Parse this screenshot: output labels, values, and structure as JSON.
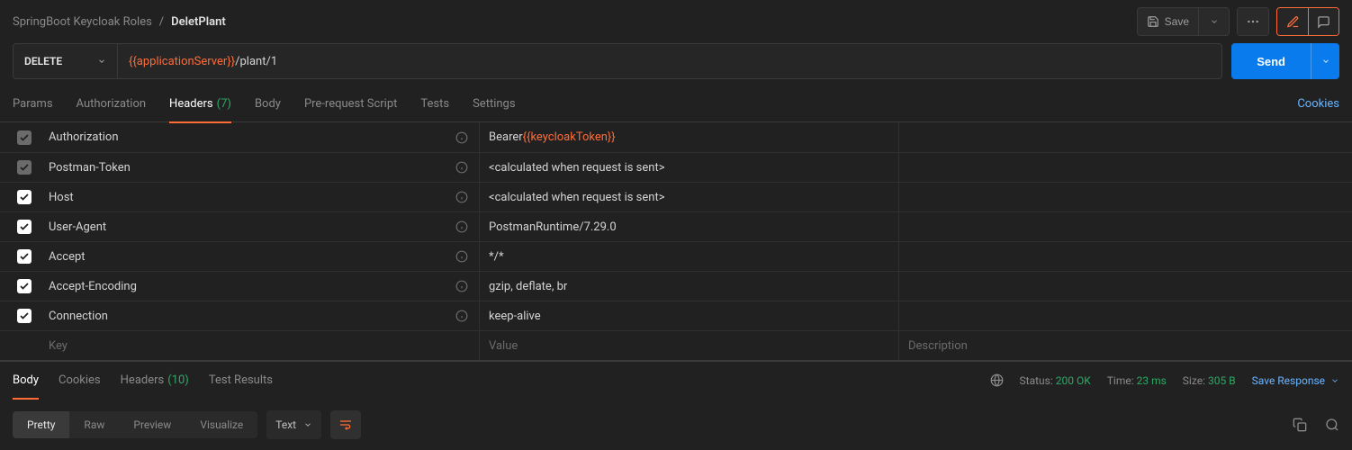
{
  "breadcrumb": {
    "collection": "SpringBoot Keycloak Roles",
    "sep": "/",
    "current": "DeletPlant"
  },
  "topbar": {
    "save_label": "Save"
  },
  "request": {
    "method": "DELETE",
    "url_variable": "{{applicationServer}}",
    "url_path": "/plant/1",
    "send_label": "Send"
  },
  "tabs": {
    "params": "Params",
    "authorization": "Authorization",
    "headers_label": "Headers",
    "headers_count": "(7)",
    "body": "Body",
    "prereq": "Pre-request Script",
    "tests": "Tests",
    "settings": "Settings",
    "cookies": "Cookies"
  },
  "headers": [
    {
      "dim": true,
      "key": "Authorization",
      "value_prefix": "Bearer ",
      "value_var": "{{keycloakToken}}",
      "value_suffix": ""
    },
    {
      "dim": true,
      "key": "Postman-Token",
      "value": "<calculated when request is sent>"
    },
    {
      "dim": false,
      "key": "Host",
      "value": "<calculated when request is sent>"
    },
    {
      "dim": false,
      "key": "User-Agent",
      "value": "PostmanRuntime/7.29.0"
    },
    {
      "dim": false,
      "key": "Accept",
      "value": "*/*"
    },
    {
      "dim": false,
      "key": "Accept-Encoding",
      "value": "gzip, deflate, br"
    },
    {
      "dim": false,
      "key": "Connection",
      "value": "keep-alive"
    }
  ],
  "header_placeholders": {
    "key": "Key",
    "value": "Value",
    "description": "Description"
  },
  "response": {
    "tabs": {
      "body": "Body",
      "cookies": "Cookies",
      "headers_label": "Headers",
      "headers_count": "(10)",
      "test_results": "Test Results"
    },
    "status_label": "Status:",
    "status_value": "200 OK",
    "time_label": "Time:",
    "time_value": "23 ms",
    "size_label": "Size:",
    "size_value": "305 B",
    "save_response": "Save Response"
  },
  "view": {
    "pretty": "Pretty",
    "raw": "Raw",
    "preview": "Preview",
    "visualize": "Visualize",
    "lang": "Text"
  }
}
